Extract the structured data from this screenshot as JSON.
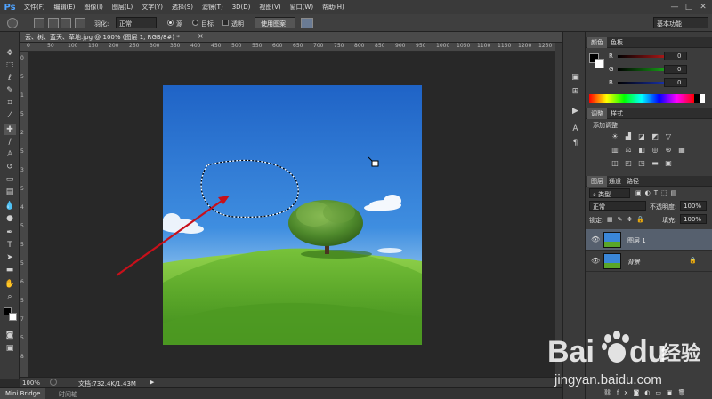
{
  "app": {
    "logo": "Ps"
  },
  "menu": [
    "文件(F)",
    "编辑(E)",
    "图像(I)",
    "图层(L)",
    "文字(Y)",
    "选择(S)",
    "滤镜(T)",
    "3D(D)",
    "视图(V)",
    "窗口(W)",
    "帮助(H)"
  ],
  "window_controls": [
    "—",
    "□",
    "✕"
  ],
  "options": {
    "feather_label": "羽化:",
    "style_value": "正常",
    "radio_normal": "源",
    "radio_target": "目标",
    "transparent": "透明",
    "use_pattern_button": "使用图案",
    "workspace_value": "基本功能"
  },
  "document_tab": {
    "title": "云、树、蓝天、草地.jpg @ 100% (图层 1, RGB/8#) *",
    "close": "×"
  },
  "ruler_top": [
    "0",
    "50",
    "100",
    "150",
    "200",
    "250",
    "300",
    "350",
    "400",
    "450",
    "500",
    "550",
    "600",
    "650",
    "700",
    "750",
    "800",
    "850",
    "900",
    "950",
    "1000",
    "1050",
    "1100",
    "1150",
    "1200",
    "1250"
  ],
  "ruler_left": [
    "0",
    "5",
    "1",
    "5",
    "2",
    "5",
    "3",
    "5",
    "4",
    "5",
    "5",
    "5",
    "6",
    "5",
    "7",
    "5",
    "8"
  ],
  "status": {
    "zoom": "100%",
    "doc_size": "文档:732.4K/1.43M",
    "arrow": "▶"
  },
  "bottom_tabs": [
    "Mini Bridge",
    "时间轴"
  ],
  "color_panel": {
    "tabs": [
      "颜色",
      "色板"
    ],
    "channels": [
      {
        "label": "R",
        "value": "0",
        "color": "#e02020"
      },
      {
        "label": "G",
        "value": "0",
        "color": "#20d020"
      },
      {
        "label": "B",
        "value": "0",
        "color": "#2040e0"
      }
    ]
  },
  "adjustments_panel": {
    "tabs": [
      "调整",
      "样式"
    ],
    "heading": "添加调整"
  },
  "layers_panel": {
    "tabs": [
      "图层",
      "通道",
      "路径"
    ],
    "filter_type": "类型",
    "blend_mode": "正常",
    "opacity_label": "不透明度:",
    "opacity_value": "100%",
    "lock_label": "锁定:",
    "fill_label": "填充:",
    "fill_value": "100%",
    "layers": [
      {
        "name": "图层 1",
        "selected": true,
        "locked": false
      },
      {
        "name": "背景",
        "selected": false,
        "locked": true
      }
    ]
  },
  "watermark": {
    "brand": "Bai",
    "brand_tail": "du",
    "product": "经验",
    "url": "jingyan.baidu.com"
  },
  "accent": {
    "arrow": "#c8101a",
    "ps_blue": "#4fa3ff",
    "selected_layer": "#56606e"
  }
}
